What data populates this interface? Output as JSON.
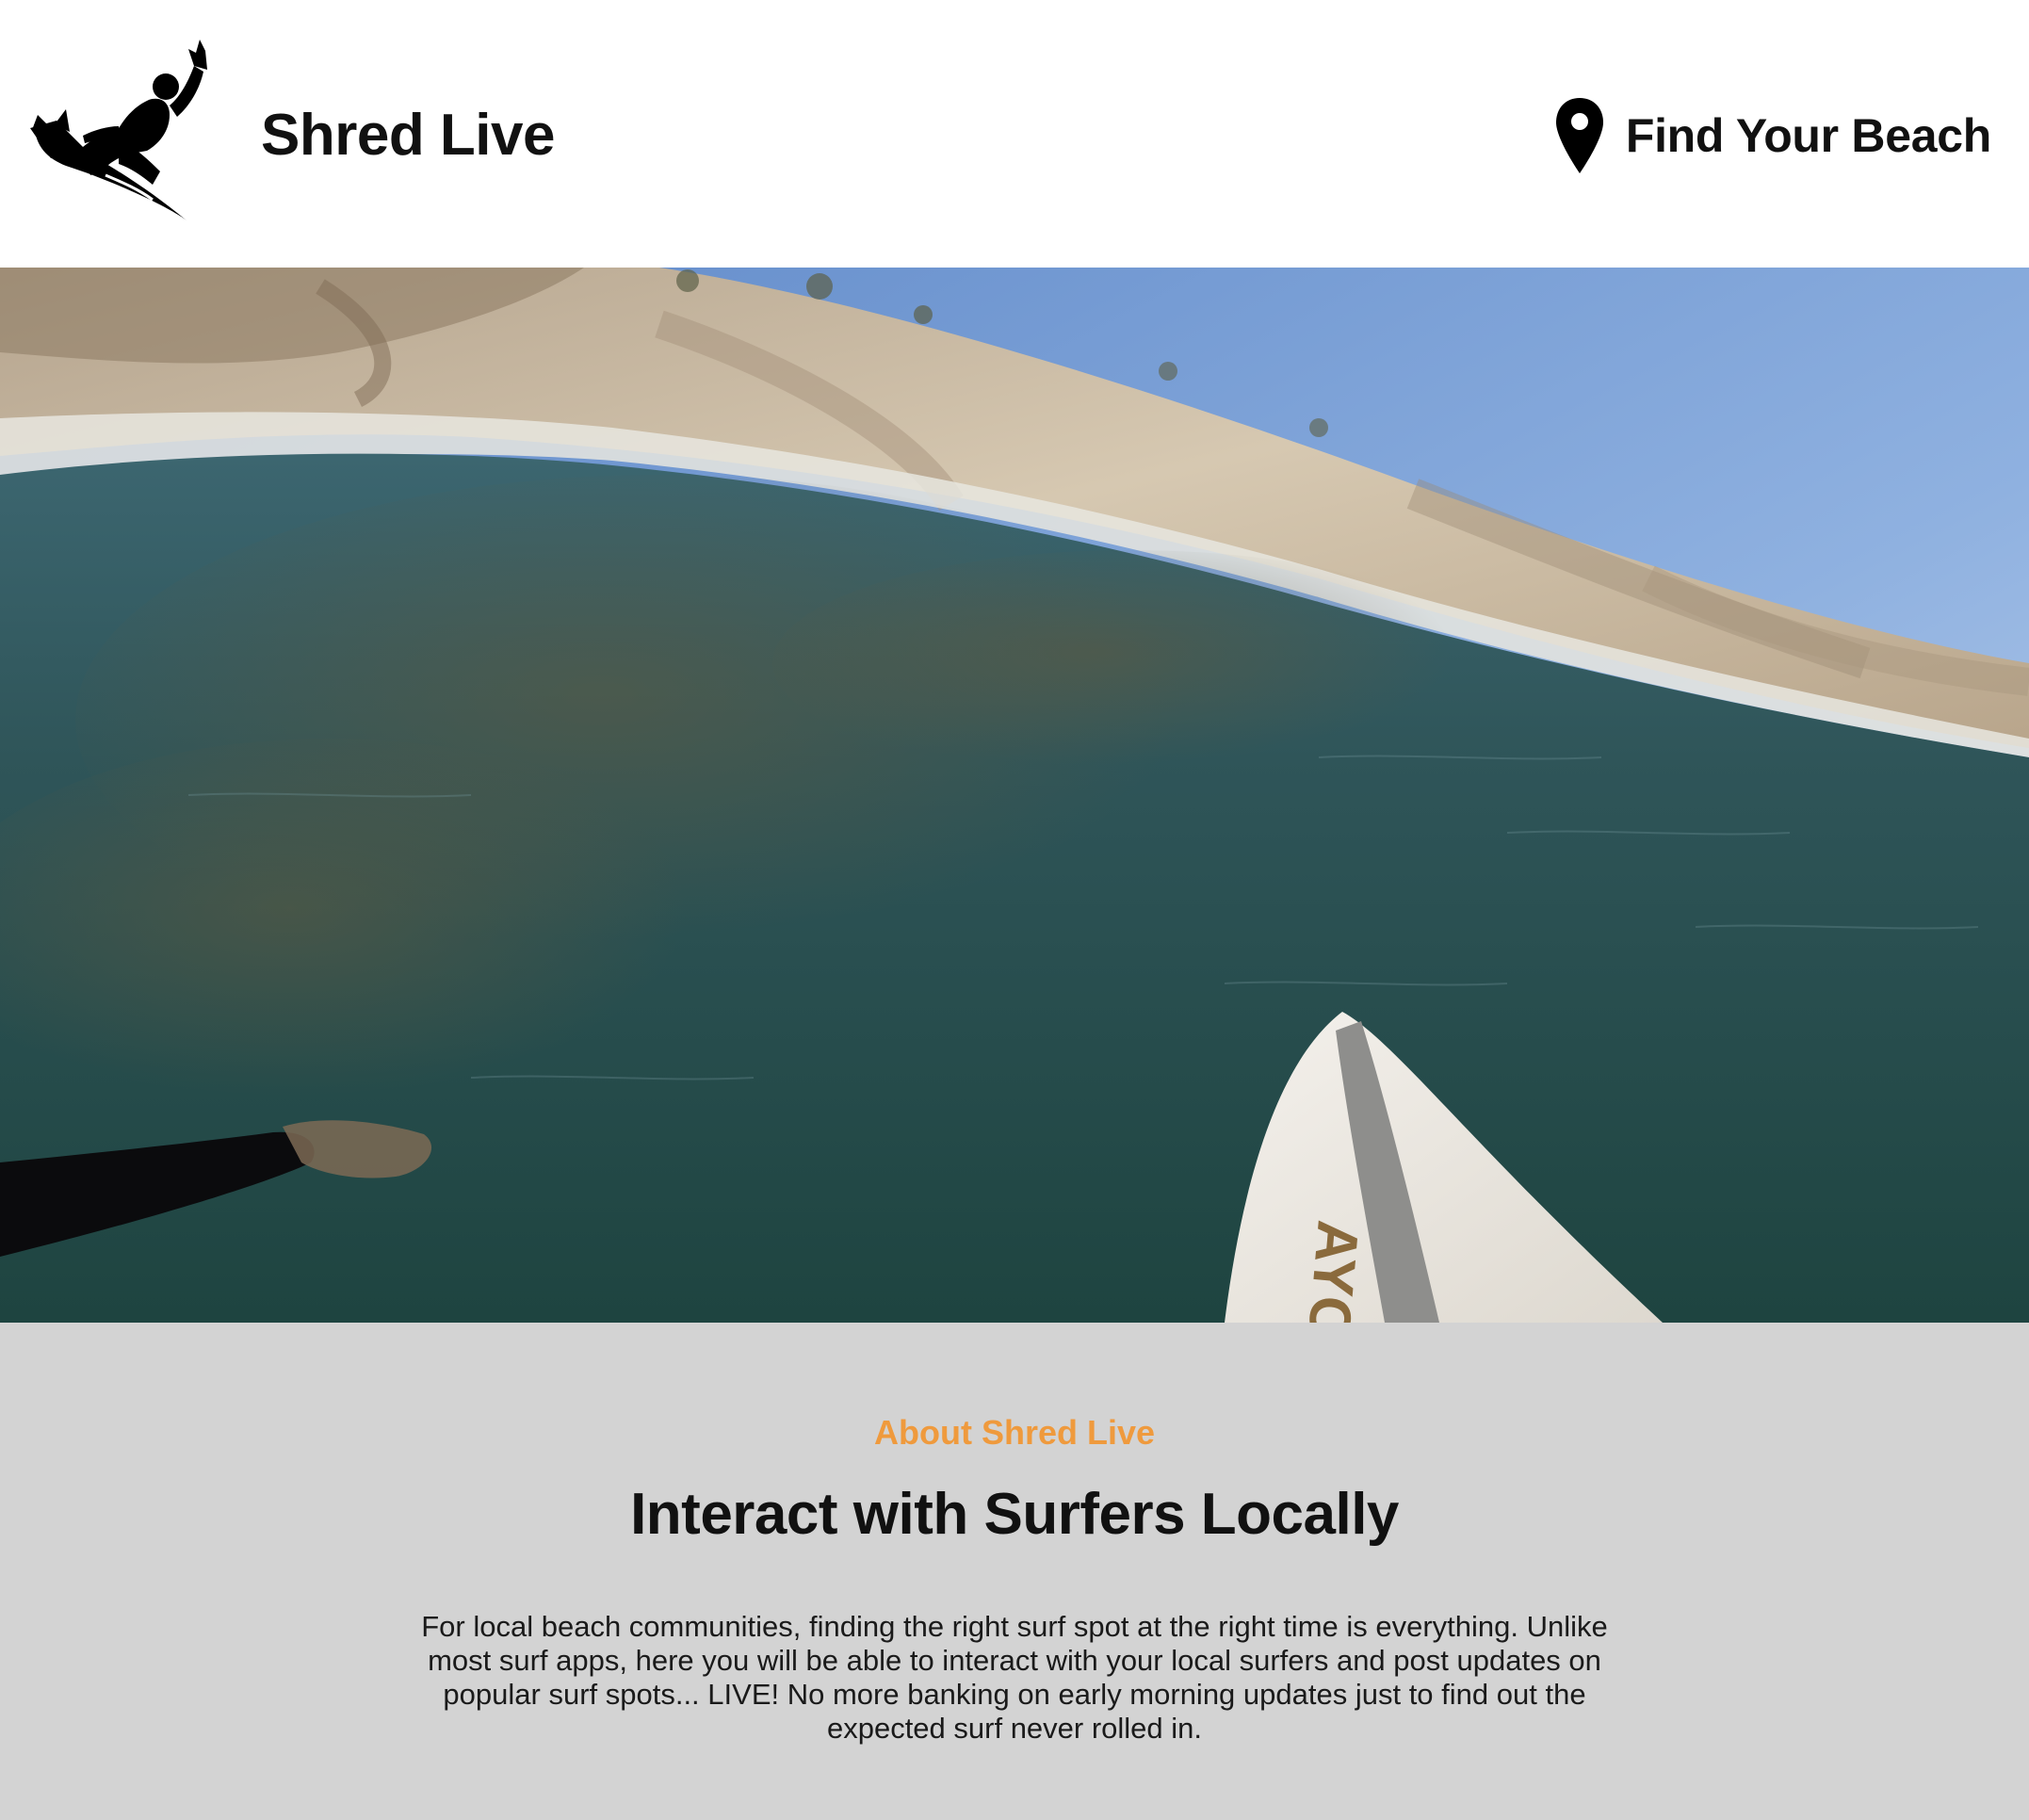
{
  "header": {
    "logo_icon": "surfer-logo-icon",
    "brand": "Shred Live",
    "nav": {
      "icon": "map-pin-icon",
      "label": "Find Your Beach"
    }
  },
  "hero": {
    "image": "surf-pov-hero-image",
    "board_text": "AYOY"
  },
  "about": {
    "eyebrow": "About Shred Live",
    "title": "Interact with Surfers Locally",
    "body": "For local beach communities, finding the right surf spot at the right time is everything. Unlike most surf apps, here you will be able to interact with your local surfers and post updates on popular surf spots... LIVE! No more banking on early morning updates just to find out the expected surf never rolled in."
  },
  "colors": {
    "accent": "#ef9a3d",
    "about_bg": "#d3d3d3",
    "header_bg": "#ffffff",
    "text": "#111111"
  }
}
